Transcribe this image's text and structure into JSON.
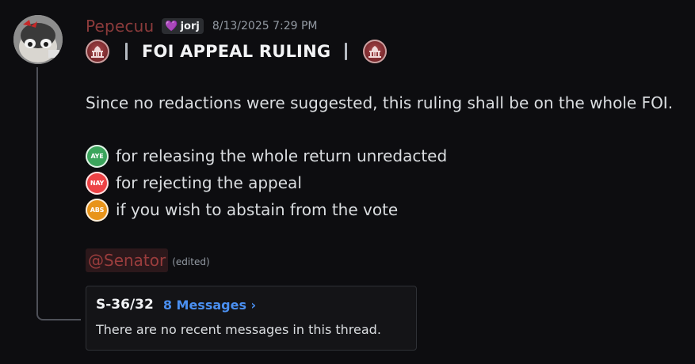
{
  "message": {
    "username": "Pepecuu",
    "tag": {
      "icon": "heart-icon",
      "label": "jorj"
    },
    "timestamp": "8/13/2025 7:29 PM",
    "title": "FOI APPEAL RULING",
    "title_icon": "capitol-seal-icon",
    "body": "Since no redactions were suggested, this ruling shall be on the whole FOI.",
    "votes": [
      {
        "badge": "AYE",
        "color": "#3ba55c",
        "text": "for releasing the whole return unredacted"
      },
      {
        "badge": "NAY",
        "color": "#ed4245",
        "text": "for rejecting the appeal"
      },
      {
        "badge": "ABS",
        "color": "#e8941a",
        "text": "if you wish to abstain from the vote"
      }
    ],
    "mention": "@Senator",
    "edited": "(edited)"
  },
  "thread": {
    "name": "S-36/32",
    "count_label": "8 Messages ›",
    "empty_text": "There are no recent messages in this thread."
  },
  "colors": {
    "background": "#0d0d10",
    "username": "#8c3b3b",
    "link": "#4a8ff0"
  }
}
